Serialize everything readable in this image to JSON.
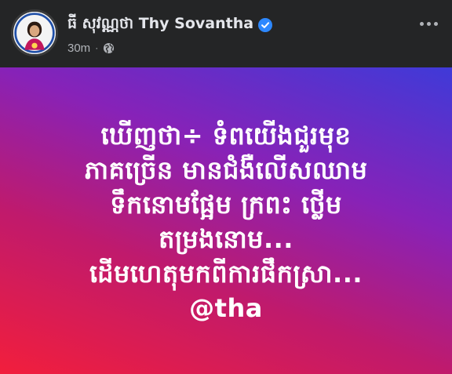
{
  "post": {
    "author_name": "ធី សុវណ្ណថា Thy Sovantha",
    "verified_icon": "verified-badge-icon",
    "timestamp": "30m",
    "separator": "·",
    "audience_icon": "globe-icon",
    "more_icon": "more-options-icon",
    "text_lines": [
      "ឃើញថា÷ ទំពយើងជួរមុខ",
      "ភាគច្រើន មានជំងឺលើសឈាម",
      "ទឹកនោមផ្អែម ក្រពះ ថ្លើម",
      "តម្រងនោម...",
      "ដើមហេតុមកពីការផឹកស្រា...",
      "@tha"
    ]
  },
  "colors": {
    "header_bg": "#242526",
    "name_text": "#e4e6eb",
    "meta_text": "#b0b3b8",
    "verified_blue": "#2d88ff",
    "gradient_start": "#f21e3c",
    "gradient_end": "#3f3ad8",
    "post_text": "#ffffff"
  }
}
